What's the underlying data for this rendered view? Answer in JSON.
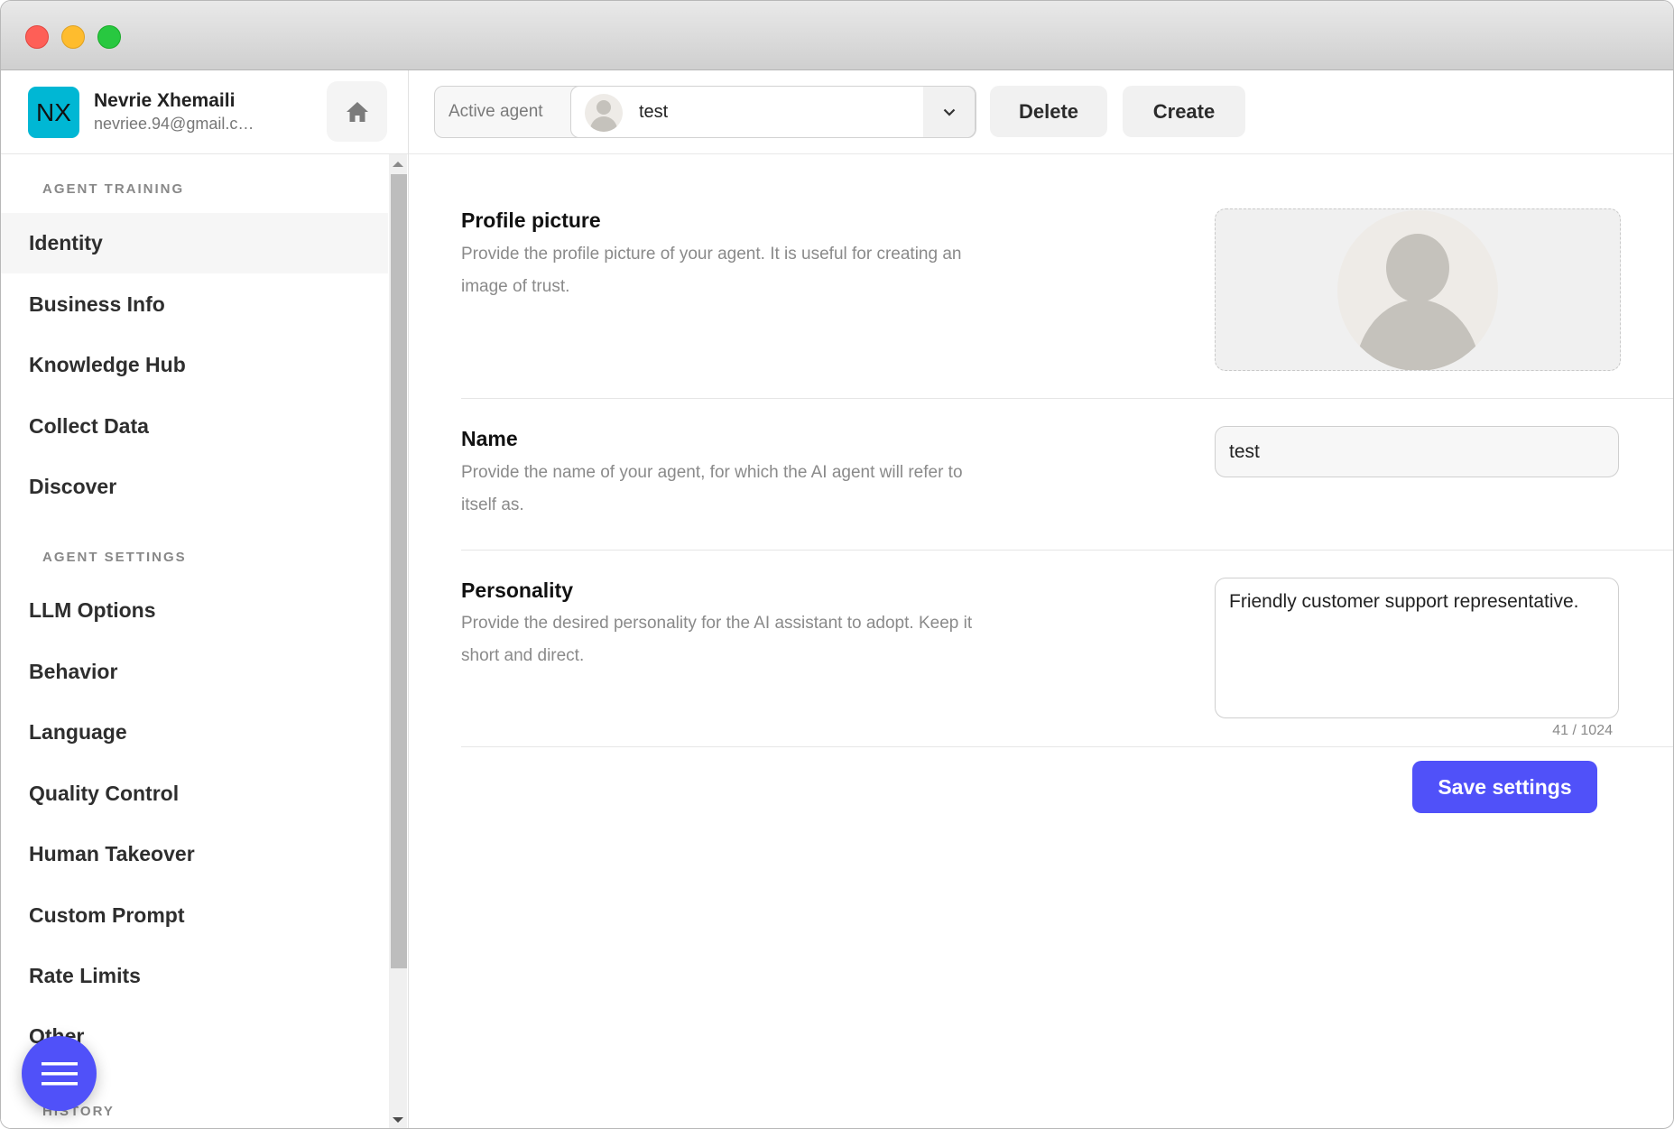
{
  "window": {
    "controls": [
      "close",
      "minimize",
      "zoom"
    ]
  },
  "user": {
    "initials": "NX",
    "name": "Nevrie Xhemaili",
    "email": "nevriee.94@gmail.c…",
    "avatar_color": "#00b7d4"
  },
  "sidebar": {
    "home_icon": "home-icon",
    "sections": [
      {
        "label": "AGENT TRAINING",
        "items": [
          {
            "label": "Identity",
            "active": true
          },
          {
            "label": "Business Info"
          },
          {
            "label": "Knowledge Hub"
          },
          {
            "label": "Collect Data"
          },
          {
            "label": "Discover"
          }
        ]
      },
      {
        "label": "AGENT SETTINGS",
        "items": [
          {
            "label": "LLM Options"
          },
          {
            "label": "Behavior"
          },
          {
            "label": "Language"
          },
          {
            "label": "Quality Control"
          },
          {
            "label": "Human Takeover"
          },
          {
            "label": "Custom Prompt"
          },
          {
            "label": "Rate Limits"
          },
          {
            "label": "Other"
          }
        ]
      },
      {
        "label": "HISTORY",
        "items": []
      }
    ],
    "fab_icon": "menu-icon"
  },
  "topbar": {
    "active_agent_label": "Active agent",
    "active_agent_value": "test",
    "delete_label": "Delete",
    "create_label": "Create"
  },
  "identity": {
    "profile_picture": {
      "title": "Profile picture",
      "description": "Provide the profile picture of your agent. It is useful for creating an image of trust."
    },
    "name": {
      "title": "Name",
      "description": "Provide the name of your agent, for which the AI agent will refer to itself as.",
      "value": "test"
    },
    "personality": {
      "title": "Personality",
      "description": "Provide the desired personality for the AI assistant to adopt. Keep it short and direct.",
      "value": "Friendly customer support representative.",
      "char_count": "41 / 1024"
    },
    "save_label": "Save settings"
  },
  "colors": {
    "accent": "#5051f9",
    "avatar": "#00b7d4"
  }
}
